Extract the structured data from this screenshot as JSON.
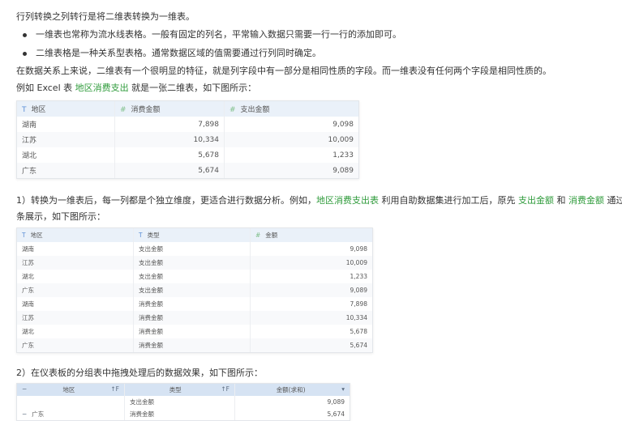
{
  "intro": "行列转换之列转行是将二维表转换为一维表。",
  "bullets": [
    "一维表也常称为流水线表格。一般有固定的列名，平常输入数据只需要一行一行的添加即可。",
    "二维表格是一种关系型表格。通常数据区域的值需要通过行列同时确定。"
  ],
  "para1": "在数据关系上来说，二维表有一个很明显的特征，就是列字段中有一部分是相同性质的字段。而一维表没有任何两个字段是相同性质的。",
  "para2": {
    "pre": "例如 Excel 表 ",
    "link": "地区消费支出",
    "post": " 就是一张二维表，如下图所示："
  },
  "table1": {
    "headers": [
      {
        "icon": "T",
        "label": "地区"
      },
      {
        "icon": "#",
        "label": "消费金额"
      },
      {
        "icon": "#",
        "label": "支出金额"
      }
    ],
    "rows": [
      [
        "湖南",
        "7,898",
        "9,098"
      ],
      [
        "江苏",
        "10,334",
        "10,009"
      ],
      [
        "湖北",
        "5,678",
        "1,233"
      ],
      [
        "广东",
        "5,674",
        "9,089"
      ]
    ]
  },
  "step1": {
    "pre": "1）转换为一维表后，每一列都是个独立维度，更适合进行数据分析。例如，",
    "link1": "地区消费支出表",
    "mid": " 利用自助数据集进行加工后，原先 ",
    "link2": "支出金额",
    "and": " 和 ",
    "link3": "消费金额",
    "post": " 通过",
    "line2": "条展示，如下图所示："
  },
  "table2": {
    "headers": [
      {
        "icon": "T",
        "label": "地区"
      },
      {
        "icon": "T",
        "label": "类型"
      },
      {
        "icon": "#",
        "label": "金额"
      }
    ],
    "rows": [
      [
        "湖南",
        "支出金额",
        "9,098"
      ],
      [
        "江苏",
        "支出金额",
        "10,009"
      ],
      [
        "湖北",
        "支出金额",
        "1,233"
      ],
      [
        "广东",
        "支出金额",
        "9,089"
      ],
      [
        "湖南",
        "消费金额",
        "7,898"
      ],
      [
        "江苏",
        "消费金额",
        "10,334"
      ],
      [
        "湖北",
        "消费金额",
        "5,678"
      ],
      [
        "广东",
        "消费金额",
        "5,674"
      ]
    ]
  },
  "step2": "2）在仪表板的分组表中拖拽处理后的数据效果，如下图所示：",
  "table3": {
    "headers": [
      "地区",
      "类型",
      "金额(求和)"
    ],
    "collapse": "−",
    "sort": "↑F",
    "dropdown": "▾",
    "rows": [
      {
        "region": "",
        "type": "支出金额",
        "value": "9,089"
      },
      {
        "region": "广东",
        "type": "消费金额",
        "value": "5,674"
      }
    ]
  }
}
